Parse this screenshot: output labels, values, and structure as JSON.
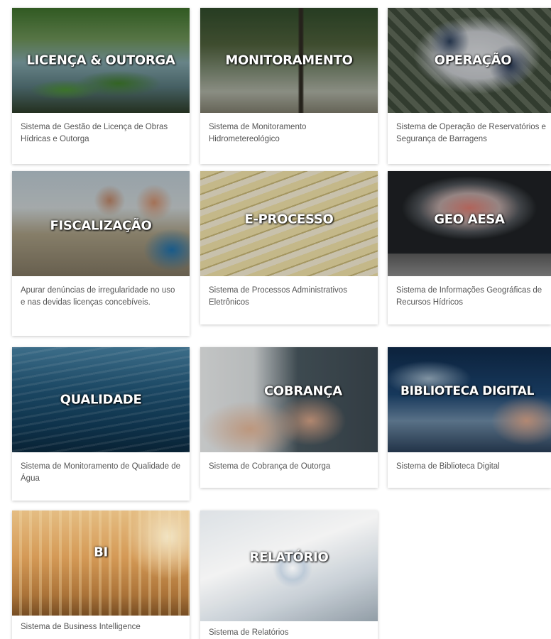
{
  "cards": [
    {
      "title": "LICENÇA & OUTORGA",
      "description": "Sistema de Gestão de Licença de Obras Hídricas e Outorga"
    },
    {
      "title": "MONITORAMENTO",
      "description": "Sistema de Monitoramento Hidrometereológico"
    },
    {
      "title": "OPERAÇÃO",
      "description": "Sistema de Operação de Reservatórios e Segurança de Barragens"
    },
    {
      "title": "FISCALIZAÇÃO",
      "description": "Apurar denúncias de irregularidade no uso e nas devidas licenças concebíveis."
    },
    {
      "title": "E-PROCESSO",
      "description": "Sistema de Processos Administrativos Eletrônicos"
    },
    {
      "title": "GEO AESA",
      "description": "Sistema de Informações Geográficas de Recursos Hídricos"
    },
    {
      "title": "QUALIDADE",
      "description": "Sistema de Monitoramento de Qualidade de Água"
    },
    {
      "title": "COBRANÇA",
      "description": "Sistema de Cobrança de Outorga"
    },
    {
      "title": "BIBLIOTECA DIGITAL",
      "description": "Sistema de Biblioteca Digital"
    },
    {
      "title": "BI",
      "description": "Sistema de Business Intelligence"
    },
    {
      "title": "RELATÓRIO",
      "description": "Sistema de Relatórios"
    }
  ]
}
